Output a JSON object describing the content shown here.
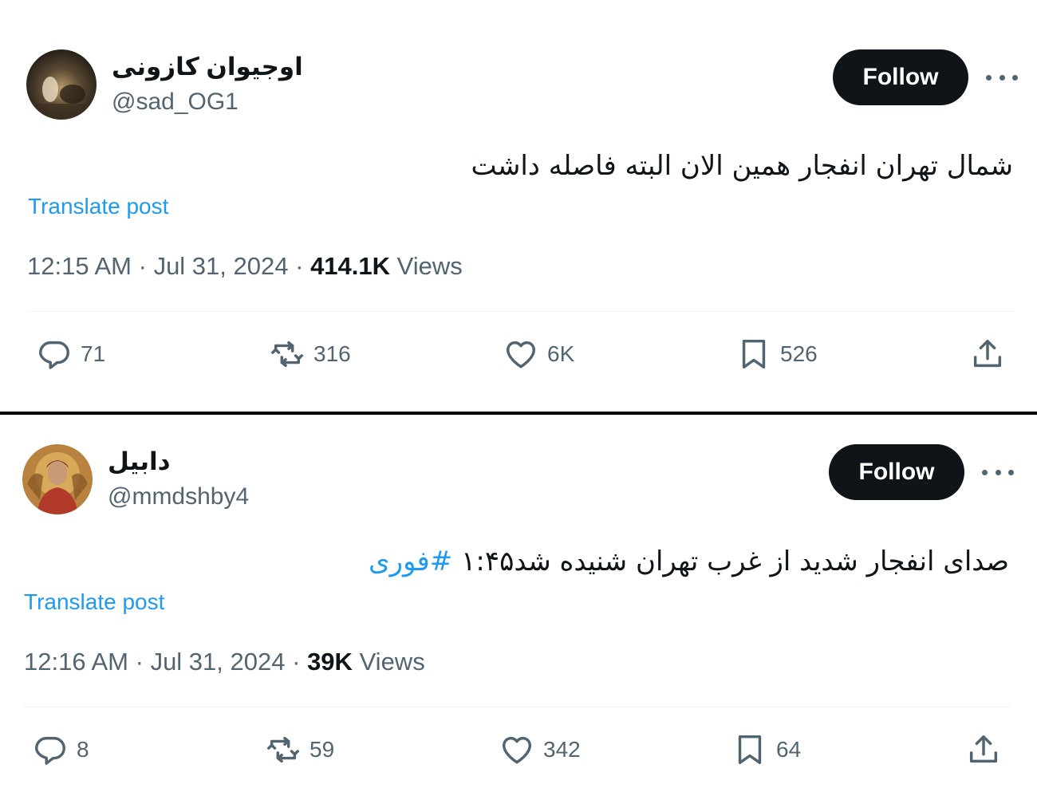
{
  "tweets": [
    {
      "display_name": "اوجیوان کازونی",
      "handle": "@sad_OG1",
      "follow_label": "Follow",
      "text": "شمال تهران انفجار همین الان البته فاصله داشت",
      "hashtag": "",
      "translate_label": "Translate post",
      "time": "12:15 AM",
      "date": "Jul 31, 2024",
      "views_count": "414.1K",
      "views_label": "Views",
      "replies": "71",
      "reposts": "316",
      "likes": "6K",
      "bookmarks": "526"
    },
    {
      "display_name": "دابیل",
      "handle": "@mmdshby4",
      "follow_label": "Follow",
      "text": "صدای انفجار شدید از غرب تهران شنیده شد۱:۴۵ ",
      "hashtag": "#فوری",
      "translate_label": "Translate post",
      "time": "12:16 AM",
      "date": "Jul 31, 2024",
      "views_count": "39K",
      "views_label": "Views",
      "replies": "8",
      "reposts": "59",
      "likes": "342",
      "bookmarks": "64"
    }
  ],
  "separator": "·",
  "icons": {
    "reply": "reply-icon",
    "repost": "repost-icon",
    "like": "heart-icon",
    "bookmark": "bookmark-icon",
    "share": "share-icon",
    "more": "more-icon"
  },
  "colors": {
    "link": "#1d9bf0",
    "muted": "#536471",
    "button": "#0f1419"
  }
}
